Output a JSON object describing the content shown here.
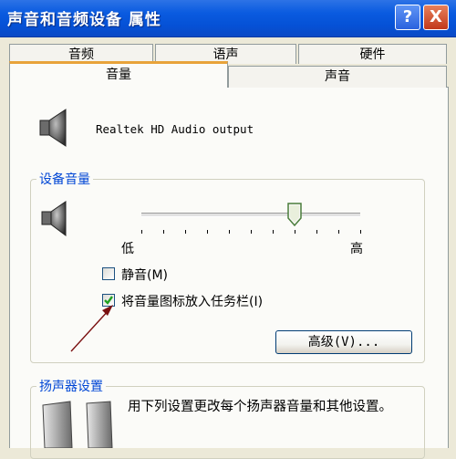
{
  "window": {
    "title": "声音和音频设备 属性"
  },
  "title_buttons": {
    "help": "?",
    "close": "X"
  },
  "tabs_row1": [
    "音频",
    "语声",
    "硬件"
  ],
  "tabs_row2": [
    "音量",
    "声音"
  ],
  "active_tab": "音量",
  "device": {
    "name": "Realtek HD Audio output"
  },
  "device_volume": {
    "group_label": "设备音量",
    "slider_min_label": "低",
    "slider_max_label": "高",
    "slider_level_percent": 70,
    "mute_label": "静音(M)",
    "mute_checked": false,
    "tray_icon_label": "将音量图标放入任务栏(I)",
    "tray_icon_checked": true,
    "advanced_button": "高级(V)..."
  },
  "speaker_settings": {
    "group_label": "扬声器设置",
    "description": "用下列设置更改每个扬声器音量和其他设置。"
  },
  "colors": {
    "title_bar": "#0551d6",
    "group_label": "#0046d5",
    "tab_highlight": "#e8a33a"
  }
}
